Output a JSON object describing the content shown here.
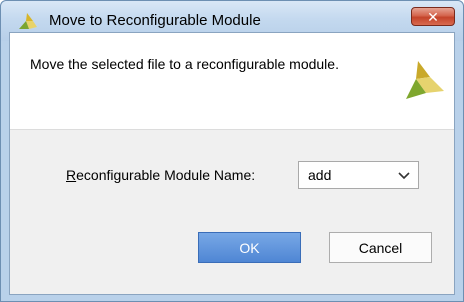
{
  "window": {
    "title": "Move to Reconfigurable Module",
    "close_glyph": "✕"
  },
  "header": {
    "message": "Move the selected file to a reconfigurable module.",
    "logo_icon": "xilinx-logo-icon"
  },
  "form": {
    "label_mnemonic": "R",
    "label_rest": "econfigurable Module Name:",
    "selected_value": "add"
  },
  "buttons": {
    "ok_label": "OK",
    "cancel_label": "Cancel"
  },
  "colors": {
    "logo_yellow": "#c9b02a",
    "logo_green": "#7fa72e",
    "ok_blue": "#5b8fd9"
  }
}
